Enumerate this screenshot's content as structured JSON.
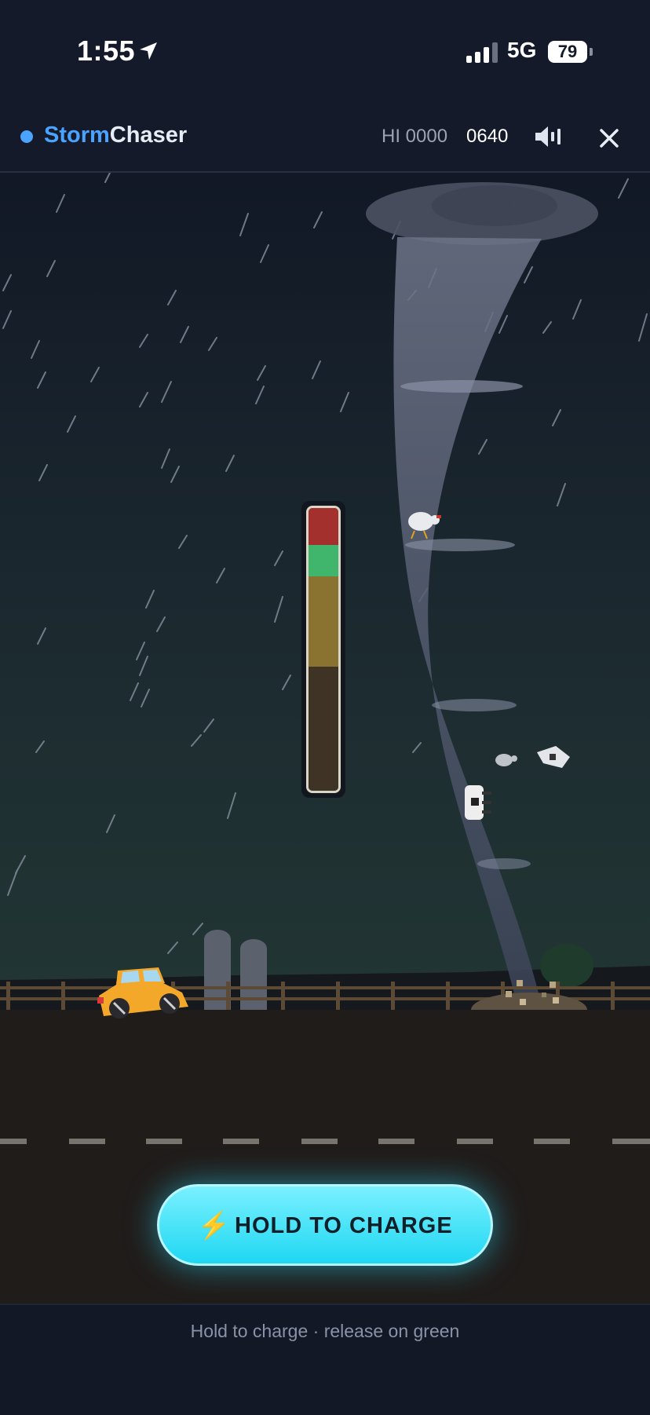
{
  "status": {
    "time": "1:55",
    "network": "5G",
    "battery": "79"
  },
  "header": {
    "brand_part1": "Storm",
    "brand_part2": "Chaser",
    "hi_label": "HI 0000",
    "score": "0640"
  },
  "meter": {
    "segments": [
      {
        "name": "danger",
        "color": "#a3302c",
        "fraction": 0.13
      },
      {
        "name": "sweet-spot",
        "color": "#3fb66b",
        "fraction": 0.11
      },
      {
        "name": "charge",
        "color": "#8a7330",
        "fraction": 0.32
      },
      {
        "name": "empty",
        "color": "#3e3325",
        "fraction": 0.44
      }
    ]
  },
  "button": {
    "icon": "⚡",
    "label": "HOLD TO CHARGE"
  },
  "footer": {
    "hint": "Hold to charge · release on green"
  },
  "colors": {
    "accent": "#4aa3ff",
    "button": "#1fd7f2"
  }
}
